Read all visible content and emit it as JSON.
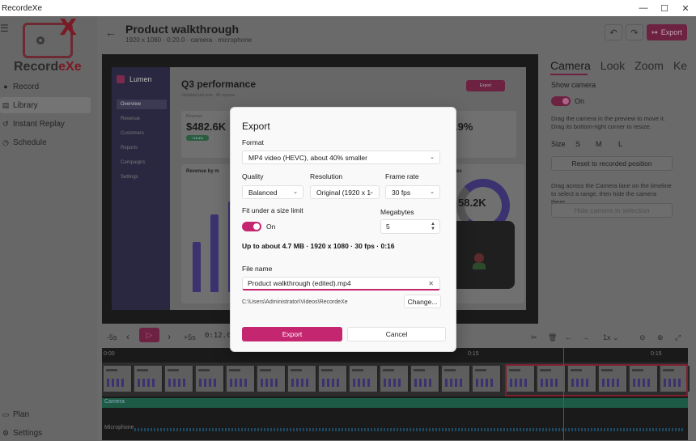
{
  "window": {
    "title": "RecordeXe",
    "minimize": "—",
    "maximize": "☐",
    "close": "✕"
  },
  "sidebar": {
    "menu_icon": "☰",
    "logo_text_a": "Record",
    "logo_text_b": "eXe",
    "items": [
      {
        "label": "Record",
        "icon": "●"
      },
      {
        "label": "Library",
        "icon": "▤"
      },
      {
        "label": "Instant Replay",
        "icon": "↺"
      },
      {
        "label": "Schedule",
        "icon": "◷"
      },
      {
        "label": "Plan",
        "icon": "▭"
      },
      {
        "label": "Settings",
        "icon": "⚙"
      }
    ]
  },
  "header": {
    "title": "Product walkthrough",
    "meta": "1920 x 1080 · 0:20.0 · camera · microphone",
    "undo": "↶",
    "redo": "↷",
    "export_label": "Export",
    "export_icon": "↦"
  },
  "preview": {
    "brand": "Lumen",
    "nav": [
      "Overview",
      "Revenue",
      "Customers",
      "Reports",
      "Campaigns",
      "Settings"
    ],
    "title": "Q3 performance",
    "subtitle": "Updated just now · All regions",
    "export_label": "Export",
    "card1_label": "Revenue",
    "card1_value": "$482.6K",
    "card1_badge": "+18.4%",
    "card2_value": ".9%",
    "chart_label": "Revenue by m",
    "donut_value": "58.2K",
    "donut_label": "es"
  },
  "right_panel": {
    "tabs": [
      "Camera",
      "Look",
      "Zoom",
      "Ke"
    ],
    "show_camera": "Show camera",
    "toggle_state": "On",
    "help1": "Drag the camera in the preview to move it. Drag its bottom-right corner to resize.",
    "size_label": "Size",
    "sizes": [
      "S",
      "M",
      "L"
    ],
    "reset_button": "Reset to recorded position",
    "help2": "Drag across the Camera lane on the timeline to select a range, then hide the camera there.",
    "hide_button": "Hide camera in selection"
  },
  "timeline_controls": {
    "back5": "-5s",
    "prev": "‹",
    "play": "▷",
    "next": "›",
    "fwd5": "+5s",
    "timecode": "0:12.0",
    "speed": "1x",
    "speed_chev": "⌄"
  },
  "timeline": {
    "ruler": [
      "0:00",
      "0:15",
      "0:15"
    ],
    "camera_lane": "Camera",
    "mic_lane": "Microphone"
  },
  "modal": {
    "title": "Export",
    "format_label": "Format",
    "format_value": "MP4 video (HEVC), about 40% smaller",
    "quality_label": "Quality",
    "quality_value": "Balanced",
    "resolution_label": "Resolution",
    "resolution_value": "Original (1920 x 1",
    "framerate_label": "Frame rate",
    "framerate_value": "30 fps",
    "fit_label": "Fit under a size limit",
    "fit_state": "On",
    "mb_label": "Megabytes",
    "mb_value": "5",
    "summary": "Up to about 4.7 MB · 1920 x 1080 · 30 fps · 0:16",
    "filename_label": "File name",
    "filename_value": "Product walkthrough (edited).mp4",
    "path": "C:\\Users\\Administrator\\Videos\\RecordeXe",
    "change_button": "Change...",
    "export_button": "Export",
    "cancel_button": "Cancel"
  },
  "colors": {
    "accent": "#c4266f",
    "accent_dim": "#6c2240",
    "camera_lane": "#1d5b46"
  }
}
